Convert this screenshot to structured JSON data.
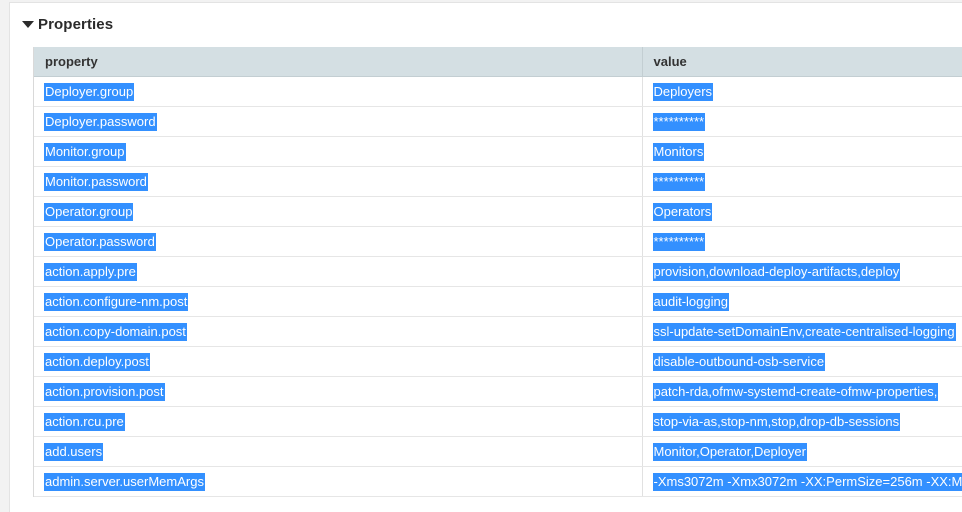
{
  "section": {
    "title": "Properties"
  },
  "table": {
    "headers": {
      "property": "property",
      "value": "value"
    },
    "rows": [
      {
        "property": "Deployer.group",
        "value": "Deployers"
      },
      {
        "property": "Deployer.password",
        "value": "**********"
      },
      {
        "property": "Monitor.group",
        "value": "Monitors"
      },
      {
        "property": "Monitor.password",
        "value": "**********"
      },
      {
        "property": "Operator.group",
        "value": "Operators"
      },
      {
        "property": "Operator.password",
        "value": "**********"
      },
      {
        "property": "action.apply.pre",
        "value": "provision,download-deploy-artifacts,deploy"
      },
      {
        "property": "action.configure-nm.post",
        "value": "audit-logging"
      },
      {
        "property": "action.copy-domain.post",
        "value": "ssl-update-setDomainEnv,create-centralised-logging"
      },
      {
        "property": "action.deploy.post",
        "value": "disable-outbound-osb-service"
      },
      {
        "property": "action.provision.post",
        "value": "patch-rda,ofmw-systemd-create-ofmw-properties,"
      },
      {
        "property": "action.rcu.pre",
        "value": "stop-via-as,stop-nm,stop,drop-db-sessions"
      },
      {
        "property": "add.users",
        "value": "Monitor,Operator,Deployer"
      },
      {
        "property": "admin.server.userMemArgs",
        "value": "-Xms3072m -Xmx3072m -XX:PermSize=256m -XX:M"
      }
    ]
  },
  "colors": {
    "header_bg": "#d4dfe3",
    "selection": "#3390ff"
  }
}
